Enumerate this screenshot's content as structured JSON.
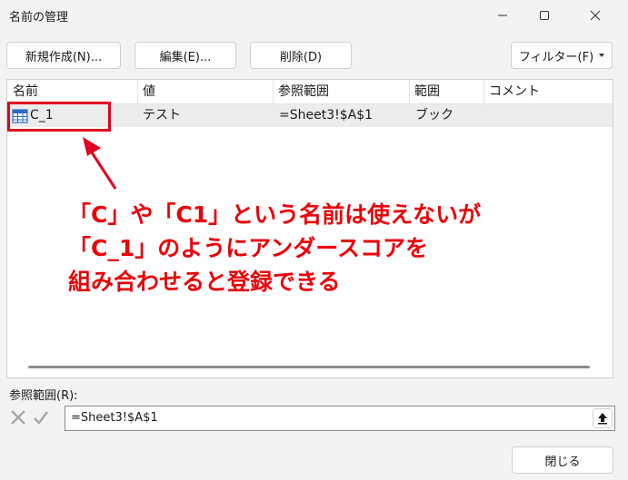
{
  "window": {
    "title": "名前の管理"
  },
  "toolbar": {
    "new_label": "新規作成(N)...",
    "edit_label": "編集(E)...",
    "delete_label": "削除(D)",
    "filter_label": "フィルター(F)"
  },
  "table": {
    "columns": [
      "名前",
      "値",
      "参照範囲",
      "範囲",
      "コメント"
    ],
    "rows": [
      {
        "name": "C_1",
        "value": "テスト",
        "refers_to": "=Sheet3!$A$1",
        "scope": "ブック",
        "comment": ""
      }
    ]
  },
  "annotation": {
    "lines": [
      "「C」や「C1」という名前は使えないが",
      "「C_1」のようにアンダースコアを",
      "組み合わせると登録できる"
    ],
    "color": "#ec0008"
  },
  "refers_to": {
    "label": "参照範囲(R):",
    "value": "=Sheet3!$A$1"
  },
  "footer": {
    "close_label": "閉じる"
  },
  "colors": {
    "accent": "#e1001e",
    "selected_row": "#ececec"
  },
  "icons": [
    "minimize-icon",
    "maximize-icon",
    "close-icon",
    "chevron-down-icon",
    "name-table-icon",
    "cancel-x-icon",
    "confirm-check-icon",
    "collapse-dialog-icon"
  ]
}
